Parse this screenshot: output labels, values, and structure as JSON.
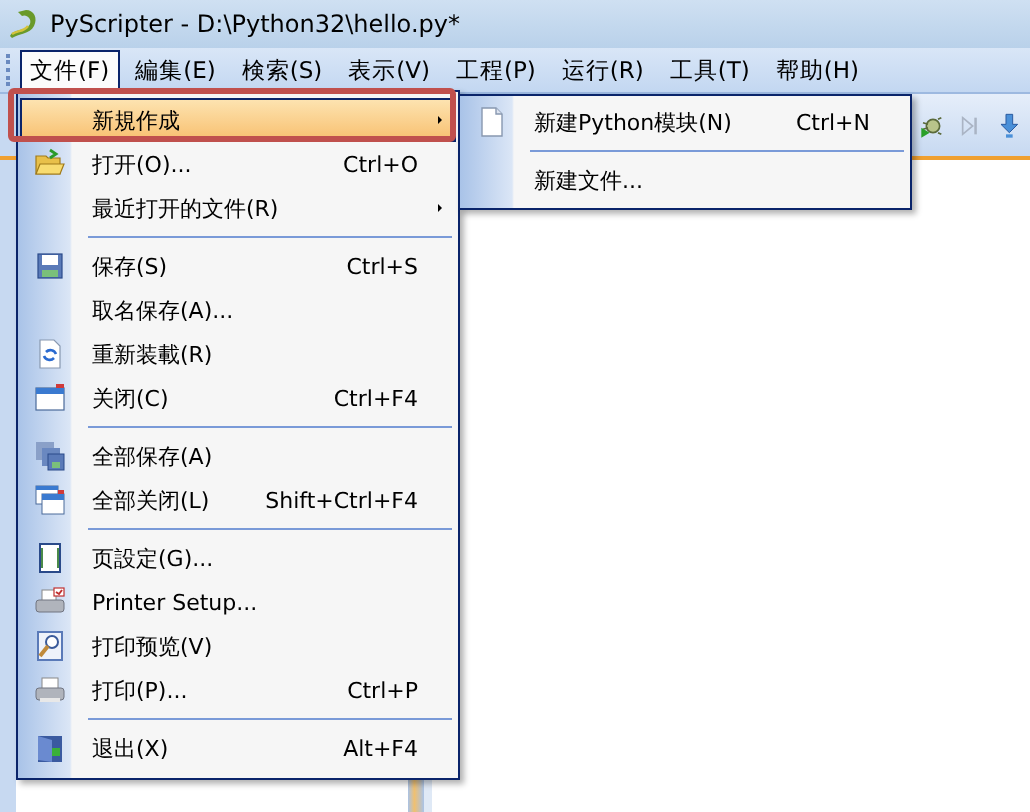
{
  "window": {
    "title": "PyScripter - D:\\Python32\\hello.py*"
  },
  "menubar": [
    {
      "label": "文件(F)",
      "selected": true
    },
    {
      "label": "編集(E)",
      "selected": false
    },
    {
      "label": "検索(S)",
      "selected": false
    },
    {
      "label": "表示(V)",
      "selected": false
    },
    {
      "label": "工程(P)",
      "selected": false
    },
    {
      "label": "运行(R)",
      "selected": false
    },
    {
      "label": "工具(T)",
      "selected": false
    },
    {
      "label": "帮助(H)",
      "selected": false
    }
  ],
  "file_menu": [
    {
      "kind": "item",
      "label": "新規作成",
      "submenu": true,
      "selected": true,
      "outlined": true
    },
    {
      "kind": "item",
      "label": "打开(O)...",
      "shortcut": "Ctrl+O",
      "submenu": false,
      "selected": false,
      "outlined": false
    },
    {
      "kind": "item",
      "label": "最近打开的文件(R)",
      "submenu": true,
      "selected": false,
      "outlined": false
    },
    {
      "kind": "separator"
    },
    {
      "kind": "item",
      "label": "保存(S)",
      "shortcut": "Ctrl+S",
      "submenu": false,
      "selected": false,
      "outlined": false
    },
    {
      "kind": "item",
      "label": "取名保存(A)...",
      "submenu": false,
      "selected": false,
      "outlined": false
    },
    {
      "kind": "item",
      "label": "重新装載(R)",
      "submenu": false,
      "selected": false,
      "outlined": false
    },
    {
      "kind": "item",
      "label": "关闭(C)",
      "shortcut": "Ctrl+F4",
      "submenu": false,
      "selected": false,
      "outlined": false
    },
    {
      "kind": "separator"
    },
    {
      "kind": "item",
      "label": "全部保存(A)",
      "submenu": false,
      "selected": false,
      "outlined": false
    },
    {
      "kind": "item",
      "label": "全部关闭(L)",
      "shortcut": "Shift+Ctrl+F4",
      "submenu": false,
      "selected": false,
      "outlined": false
    },
    {
      "kind": "separator"
    },
    {
      "kind": "item",
      "label": "页設定(G)...",
      "submenu": false,
      "selected": false,
      "outlined": false
    },
    {
      "kind": "item",
      "label": "Printer Setup...",
      "submenu": false,
      "selected": false,
      "outlined": false
    },
    {
      "kind": "item",
      "label": "打印预览(V)",
      "submenu": false,
      "selected": false,
      "outlined": false
    },
    {
      "kind": "item",
      "label": "打印(P)...",
      "shortcut": "Ctrl+P",
      "submenu": false,
      "selected": false,
      "outlined": false
    },
    {
      "kind": "separator"
    },
    {
      "kind": "item",
      "label": "退出(X)",
      "shortcut": "Alt+F4",
      "submenu": false,
      "selected": false,
      "outlined": false
    }
  ],
  "new_submenu": [
    {
      "kind": "item",
      "label": "新建Python模块(N)",
      "shortcut": "Ctrl+N"
    },
    {
      "kind": "separator"
    },
    {
      "kind": "item",
      "label": "新建文件..."
    }
  ]
}
